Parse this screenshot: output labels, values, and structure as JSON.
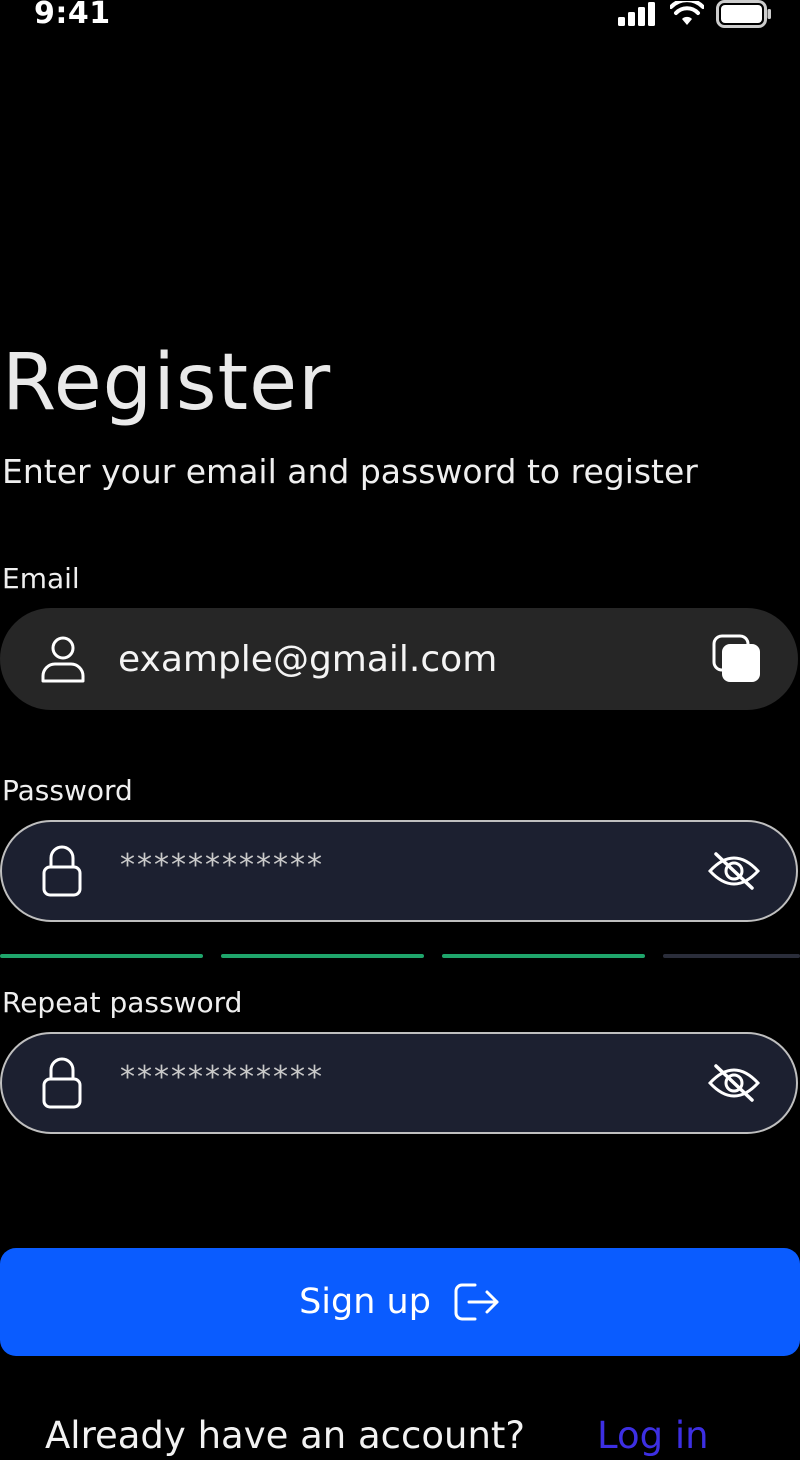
{
  "status_bar": {
    "time": "9:41"
  },
  "header": {
    "title": "Register",
    "subtitle": "Enter your email and password to register"
  },
  "form": {
    "email_label": "Email",
    "email_value": "example@gmail.com",
    "password_label": "Password",
    "password_value": "************",
    "repeat_label": "Repeat password",
    "repeat_value": "************",
    "strength": {
      "filled_segments": 3,
      "total_segments": 4
    }
  },
  "actions": {
    "signup_label": "Sign up"
  },
  "footer": {
    "question": "Already have an account?",
    "link": "Log in"
  },
  "colors": {
    "accent": "#0a5cff",
    "strength_filled": "#1fa56b",
    "strength_empty": "#2a2d3a",
    "link": "#3d2fe3"
  },
  "icons": {
    "email_leading": "user-icon",
    "email_trailing": "copy-icon",
    "password_leading": "lock-icon",
    "password_trailing": "eye-off-icon",
    "signup": "logout-arrow-icon"
  }
}
